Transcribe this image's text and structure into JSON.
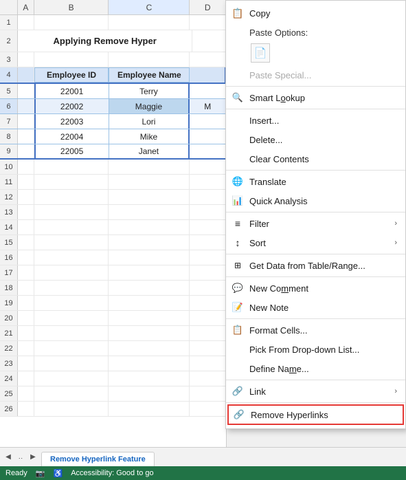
{
  "spreadsheet": {
    "title": "Applying Remove Hyper",
    "columns": [
      "A",
      "B",
      "C",
      "D"
    ],
    "col_headers": [
      "",
      "A",
      "B",
      "C",
      "D"
    ],
    "rows": [
      {
        "num": 1,
        "cells": [
          "",
          "",
          "",
          ""
        ]
      },
      {
        "num": 2,
        "cells": [
          "title",
          "Applying Remove Hyper",
          "",
          ""
        ]
      },
      {
        "num": 3,
        "cells": [
          "",
          "",
          "",
          ""
        ]
      },
      {
        "num": 4,
        "cells": [
          "header",
          "Employee ID",
          "Employee Name",
          ""
        ]
      },
      {
        "num": 5,
        "cells": [
          "data",
          "22001",
          "Terry",
          ""
        ]
      },
      {
        "num": 6,
        "cells": [
          "data",
          "22002",
          "Maggie",
          "M"
        ]
      },
      {
        "num": 7,
        "cells": [
          "data",
          "22003",
          "Lori",
          ""
        ]
      },
      {
        "num": 8,
        "cells": [
          "data",
          "22004",
          "Mike",
          ""
        ]
      },
      {
        "num": 9,
        "cells": [
          "data",
          "22005",
          "Janet",
          ""
        ]
      },
      {
        "num": 10,
        "cells": [
          "",
          "",
          "",
          ""
        ]
      },
      {
        "num": 11,
        "cells": [
          "",
          "",
          "",
          ""
        ]
      },
      {
        "num": 12,
        "cells": [
          "",
          "",
          "",
          ""
        ]
      },
      {
        "num": 13,
        "cells": [
          "",
          "",
          "",
          ""
        ]
      },
      {
        "num": 14,
        "cells": [
          "",
          "",
          "",
          ""
        ]
      },
      {
        "num": 15,
        "cells": [
          "",
          "",
          "",
          ""
        ]
      },
      {
        "num": 16,
        "cells": [
          "",
          "",
          "",
          ""
        ]
      },
      {
        "num": 17,
        "cells": [
          "",
          "",
          "",
          ""
        ]
      },
      {
        "num": 18,
        "cells": [
          "",
          "",
          "",
          ""
        ]
      },
      {
        "num": 19,
        "cells": [
          "",
          "",
          "",
          ""
        ]
      },
      {
        "num": 20,
        "cells": [
          "",
          "",
          "",
          ""
        ]
      },
      {
        "num": 21,
        "cells": [
          "",
          "",
          "",
          ""
        ]
      },
      {
        "num": 22,
        "cells": [
          "",
          "",
          "",
          ""
        ]
      },
      {
        "num": 23,
        "cells": [
          "",
          "",
          "",
          ""
        ]
      },
      {
        "num": 24,
        "cells": [
          "",
          "",
          "",
          ""
        ]
      },
      {
        "num": 25,
        "cells": [
          "",
          "",
          "",
          ""
        ]
      },
      {
        "num": 26,
        "cells": [
          "",
          "",
          "",
          ""
        ]
      }
    ]
  },
  "context_menu": {
    "items": [
      {
        "id": "copy",
        "icon": "📋",
        "label": "Copy",
        "has_arrow": false,
        "disabled": false,
        "type": "item"
      },
      {
        "id": "paste-options-label",
        "icon": "",
        "label": "Paste Options:",
        "has_arrow": false,
        "disabled": false,
        "type": "label"
      },
      {
        "id": "paste-icon",
        "icon": "📄",
        "label": "",
        "has_arrow": false,
        "disabled": false,
        "type": "paste-icon"
      },
      {
        "id": "paste-special",
        "icon": "",
        "label": "Paste Special...",
        "has_arrow": false,
        "disabled": true,
        "type": "item"
      },
      {
        "id": "sep1",
        "type": "separator"
      },
      {
        "id": "smart-lookup",
        "icon": "🔍",
        "label": "Smart Lookup",
        "has_arrow": false,
        "disabled": false,
        "type": "item"
      },
      {
        "id": "sep2",
        "type": "separator"
      },
      {
        "id": "insert",
        "icon": "",
        "label": "Insert...",
        "has_arrow": false,
        "disabled": false,
        "type": "item"
      },
      {
        "id": "delete",
        "icon": "",
        "label": "Delete...",
        "has_arrow": false,
        "disabled": false,
        "type": "item"
      },
      {
        "id": "clear-contents",
        "icon": "",
        "label": "Clear Contents",
        "has_arrow": false,
        "disabled": false,
        "type": "item"
      },
      {
        "id": "sep3",
        "type": "separator"
      },
      {
        "id": "translate",
        "icon": "🌐",
        "label": "Translate",
        "has_arrow": false,
        "disabled": false,
        "type": "item"
      },
      {
        "id": "quick-analysis",
        "icon": "📊",
        "label": "Quick Analysis",
        "has_arrow": false,
        "disabled": false,
        "type": "item"
      },
      {
        "id": "sep4",
        "type": "separator"
      },
      {
        "id": "filter",
        "icon": "",
        "label": "Filter",
        "has_arrow": true,
        "disabled": false,
        "type": "item"
      },
      {
        "id": "sort",
        "icon": "",
        "label": "Sort",
        "has_arrow": true,
        "disabled": false,
        "type": "item"
      },
      {
        "id": "sep5",
        "type": "separator"
      },
      {
        "id": "get-data",
        "icon": "📋",
        "label": "Get Data from Table/Range...",
        "has_arrow": false,
        "disabled": false,
        "type": "item"
      },
      {
        "id": "sep6",
        "type": "separator"
      },
      {
        "id": "new-comment",
        "icon": "💬",
        "label": "New Comment",
        "has_arrow": false,
        "disabled": false,
        "type": "item"
      },
      {
        "id": "new-note",
        "icon": "📝",
        "label": "New Note",
        "has_arrow": false,
        "disabled": false,
        "type": "item"
      },
      {
        "id": "sep7",
        "type": "separator"
      },
      {
        "id": "format-cells",
        "icon": "📋",
        "label": "Format Cells...",
        "has_arrow": false,
        "disabled": false,
        "type": "item"
      },
      {
        "id": "pick-from-dropdown",
        "icon": "",
        "label": "Pick From Drop-down List...",
        "has_arrow": false,
        "disabled": false,
        "type": "item"
      },
      {
        "id": "define-name",
        "icon": "",
        "label": "Define Name...",
        "has_arrow": false,
        "disabled": false,
        "type": "item"
      },
      {
        "id": "sep8",
        "type": "separator"
      },
      {
        "id": "link",
        "icon": "🔗",
        "label": "Link",
        "has_arrow": true,
        "disabled": false,
        "type": "item"
      },
      {
        "id": "sep9",
        "type": "separator"
      },
      {
        "id": "remove-hyperlinks",
        "icon": "🔗",
        "label": "Remove Hyperlinks",
        "has_arrow": false,
        "disabled": false,
        "type": "item",
        "highlighted": true
      }
    ]
  },
  "tab_bar": {
    "sheet_name": "Remove Hyperlink Feature"
  },
  "status_bar": {
    "ready_label": "Ready",
    "accessibility_label": "Accessibility: Good to go"
  }
}
